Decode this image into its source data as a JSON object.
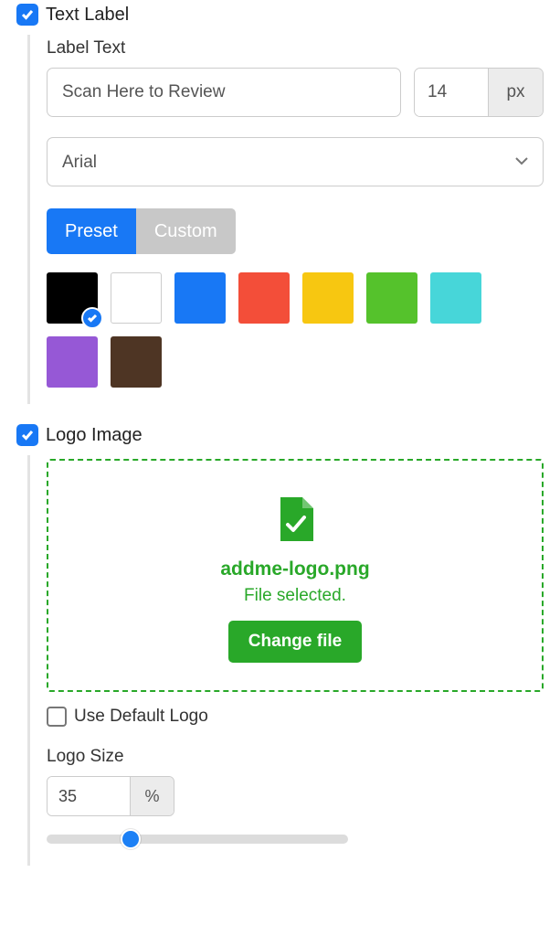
{
  "textLabel": {
    "title": "Text Label",
    "checked": true,
    "labelTextLabel": "Label Text",
    "labelTextValue": "Scan Here to Review",
    "fontSizeValue": "14",
    "fontSizeUnit": "px",
    "fontFamily": "Arial",
    "tabPreset": "Preset",
    "tabCustom": "Custom",
    "swatches": [
      {
        "color": "#000000",
        "selected": true
      },
      {
        "color": "#ffffff",
        "bordered": true
      },
      {
        "color": "#1878f5"
      },
      {
        "color": "#f34e39"
      },
      {
        "color": "#f7c711"
      },
      {
        "color": "#55c22c"
      },
      {
        "color": "#47d6d9"
      },
      {
        "color": "#9658d6"
      },
      {
        "color": "#4e3524"
      }
    ]
  },
  "logoImage": {
    "title": "Logo Image",
    "checked": true,
    "fileName": "addme-logo.png",
    "fileStatus": "File selected.",
    "changeFile": "Change file",
    "useDefaultLabel": "Use Default Logo",
    "useDefaultChecked": false,
    "logoSizeLabel": "Logo Size",
    "logoSizeValue": "35",
    "logoSizeUnit": "%",
    "sliderPercent": 28
  }
}
